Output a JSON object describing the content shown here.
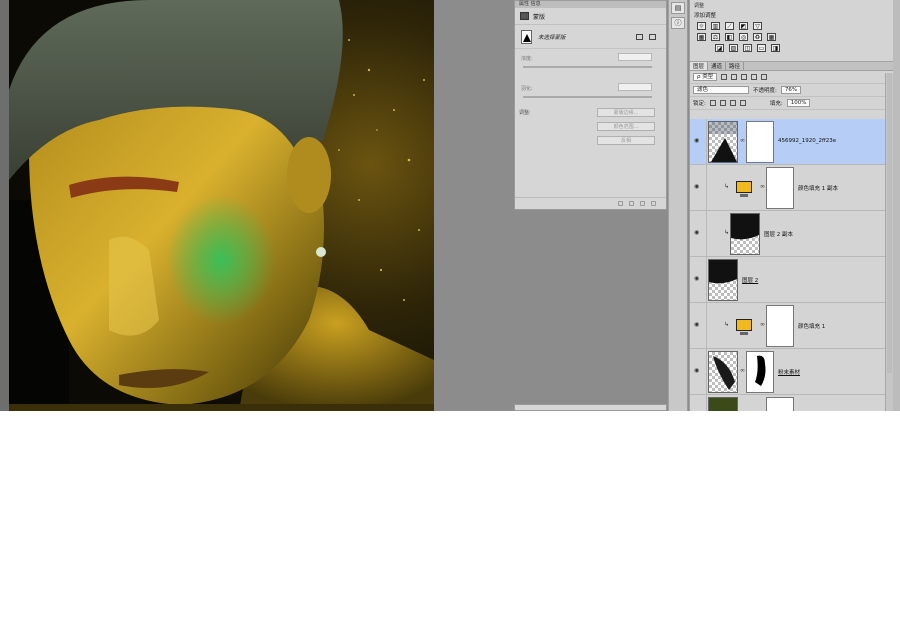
{
  "properties_panel": {
    "tabs": "属性   信息",
    "header_title": "蒙版",
    "mask_label": "未选择蒙版",
    "density_label": "浓度:",
    "feather_label": "羽化:",
    "adjust_label": "调整:",
    "buttons": [
      "蒙版边缘...",
      "颜色范围...",
      "反相"
    ]
  },
  "mini_strip": {
    "icons": [
      "history-icon",
      "info-icon"
    ]
  },
  "adjustments": {
    "tab_label": "调整",
    "title": "添加调整",
    "row1": [
      "brightness-icon",
      "levels-icon",
      "curves-icon",
      "exposure-icon",
      "vibrance-icon"
    ],
    "row2": [
      "hue-icon",
      "color-balance-icon",
      "bw-icon",
      "photo-filter-icon",
      "channel-mixer-icon",
      "lookup-icon"
    ],
    "row3": [
      "invert-icon",
      "posterize-icon",
      "threshold-icon",
      "gradient-map-icon",
      "selective-color-icon"
    ]
  },
  "layers_panel": {
    "tabs": [
      "图层",
      "通道",
      "路径"
    ],
    "filter_kind": "ρ 类型",
    "blend_mode": "滤色",
    "opacity_label": "不透明度:",
    "opacity_value": "76%",
    "lock_label": "锁定:",
    "fill_label": "填充:",
    "fill_value": "100%",
    "layers": [
      {
        "name": "456992_1920_2ff23e",
        "selected": true
      },
      {
        "name": "颜色填充 1 副本",
        "clipped": true
      },
      {
        "name": "图层 2 副本",
        "clipped": true
      },
      {
        "name": "图层 2"
      },
      {
        "name": "颜色填充 1",
        "clipped": true
      },
      {
        "name": "粉末素材"
      },
      {
        "name": ""
      }
    ]
  },
  "colors": {
    "fill_swatch": "#f0b91e",
    "selection": "#b6cdf5",
    "workspace": "#8c8c8c"
  }
}
